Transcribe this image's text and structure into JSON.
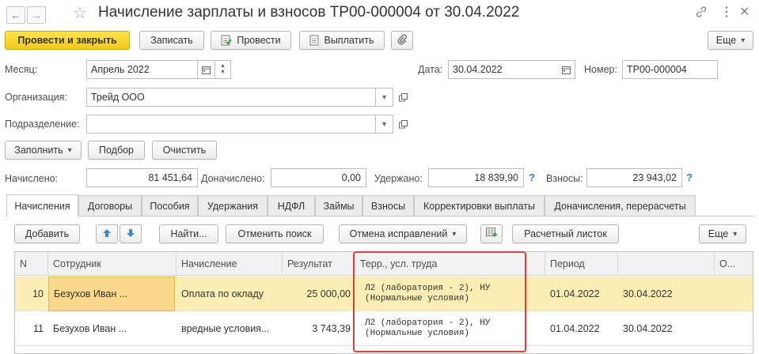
{
  "header": {
    "title": "Начисление зарплаты и взносов ТР00-000004 от 30.04.2022"
  },
  "toolbar": {
    "post_close": "Провести и закрыть",
    "save": "Записать",
    "post": "Провести",
    "pay": "Выплатить",
    "more": "Еще"
  },
  "form": {
    "month_label": "Месяц:",
    "month_value": "Апрель 2022",
    "date_label": "Дата:",
    "date_value": "30.04.2022",
    "number_label": "Номер:",
    "number_value": "ТР00-000004",
    "org_label": "Организация:",
    "org_value": "Трейд ООО",
    "dept_label": "Подразделение:",
    "dept_value": ""
  },
  "actions": {
    "fill": "Заполнить",
    "select": "Подбор",
    "clear": "Очистить"
  },
  "totals": {
    "accrued_label": "Начислено:",
    "accrued_value": "81 451,64",
    "extra_label": "Доначислено:",
    "extra_value": "0,00",
    "withheld_label": "Удержано:",
    "withheld_value": "18 839,90",
    "contrib_label": "Взносы:",
    "contrib_value": "23 943,02",
    "help": "?"
  },
  "tabs": [
    "Начисления",
    "Договоры",
    "Пособия",
    "Удержания",
    "НДФЛ",
    "Займы",
    "Взносы",
    "Корректировки выплаты",
    "Доначисления, перерасчеты"
  ],
  "table_toolbar": {
    "add": "Добавить",
    "find": "Найти...",
    "cancel_search": "Отменить поиск",
    "cancel_fix": "Отмена исправлений",
    "payslip": "Расчетный листок",
    "more": "Еще"
  },
  "table": {
    "columns": [
      "N",
      "Сотрудник",
      "Начисление",
      "Результат",
      "Терр., усл. труда",
      "Период",
      "",
      "О..."
    ],
    "rows": [
      {
        "n": "10",
        "employee": "Безухов Иван ...",
        "accrual": "Оплата по окладу",
        "result": "25 000,00",
        "territory": "Л2 (лаборатория - 2), НУ\n(Нормальные условия)",
        "period_from": "01.04.2022",
        "period_to": "30.04.2022"
      },
      {
        "n": "11",
        "employee": "Безухов Иван ...",
        "accrual": "вредные условия...",
        "result": "3 743,39",
        "territory": "Л2 (лаборатория - 2), НУ\n(Нормальные условия)",
        "period_from": "01.04.2022",
        "period_to": "30.04.2022"
      }
    ]
  },
  "colors": {
    "primary_button": "#f5cf1f",
    "selected_row": "#fbeeb4",
    "highlight_box": "#d9413b",
    "help_icon": "#2b7bd3"
  }
}
